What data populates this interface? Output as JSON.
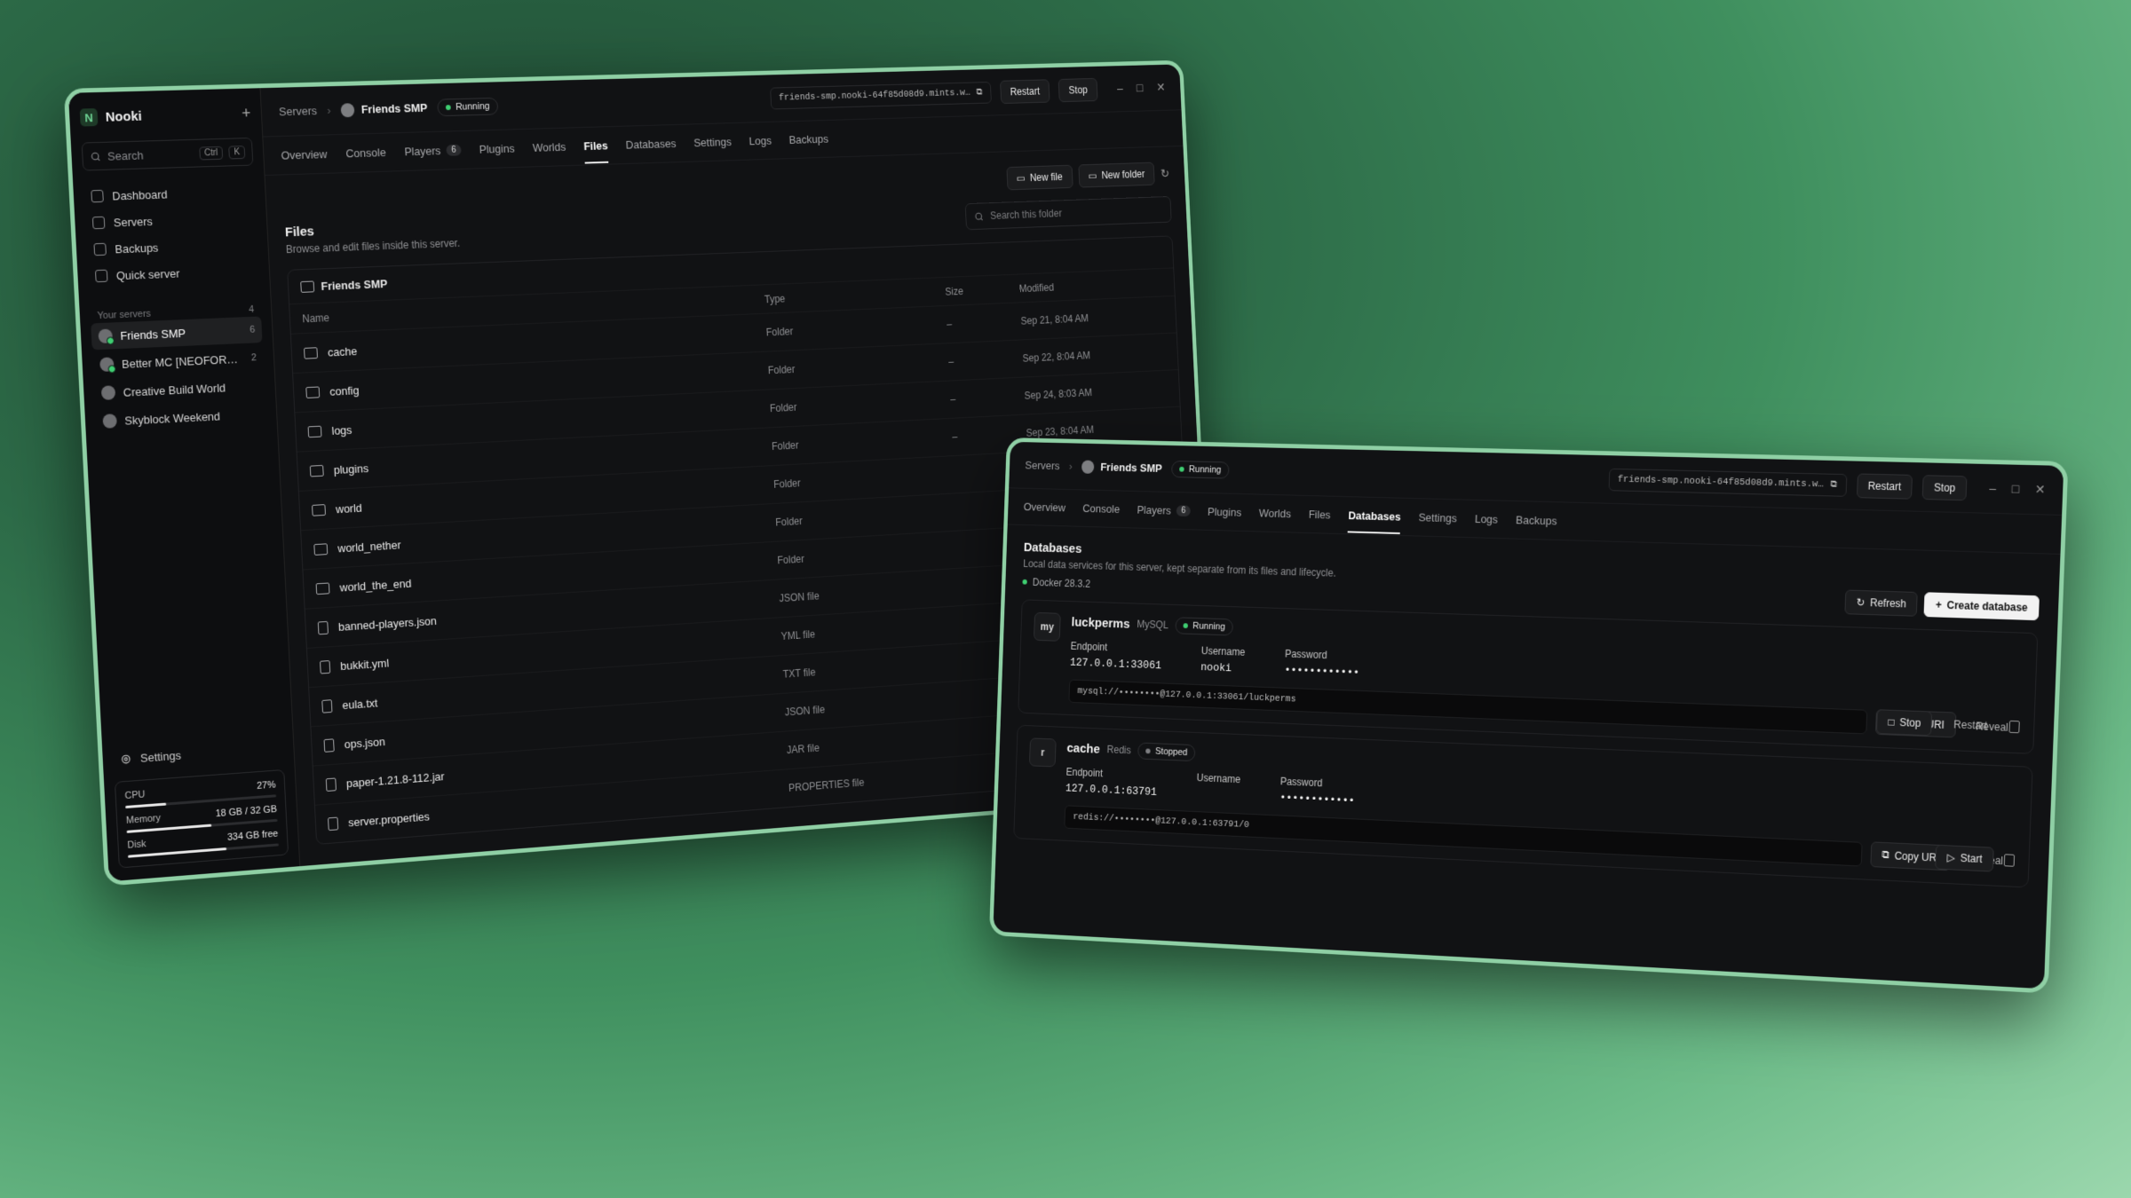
{
  "files_window": {
    "sidebar": {
      "app_name": "Nooki",
      "logo_letter": "N",
      "search_placeholder": "Search",
      "shortcut": [
        "Ctrl",
        "K"
      ],
      "nav": [
        "Dashboard",
        "Servers",
        "Backups",
        "Quick server"
      ],
      "section_label": "Your servers",
      "section_count": "4",
      "servers": [
        {
          "name": "Friends SMP",
          "count": "6",
          "active": true
        },
        {
          "name": "Better MC [NEOFORGE] ...",
          "count": "2",
          "active": false
        },
        {
          "name": "Creative Build World",
          "count": "",
          "active": false
        },
        {
          "name": "Skyblock Weekend",
          "count": "",
          "active": false
        }
      ],
      "settings_label": "Settings",
      "stats": {
        "cpu": {
          "label": "CPU",
          "value": "27%",
          "fraction": 0.27
        },
        "memory": {
          "label": "Memory",
          "value": "18 GB / 32 GB",
          "fraction": 0.56
        },
        "disk": {
          "label": "Disk",
          "value": "334 GB free",
          "fraction": 0.65
        }
      }
    },
    "header": {
      "breadcrumb_root": "Servers",
      "server_name": "Friends SMP",
      "status": "Running",
      "address": "friends-smp.nooki-64f85d08d9.mints.w…",
      "restart_label": "Restart",
      "stop_label": "Stop"
    },
    "tabs": [
      {
        "label": "Overview"
      },
      {
        "label": "Console"
      },
      {
        "label": "Players",
        "badge": "6"
      },
      {
        "label": "Plugins"
      },
      {
        "label": "Worlds"
      },
      {
        "label": "Files",
        "active": true
      },
      {
        "label": "Databases"
      },
      {
        "label": "Settings"
      },
      {
        "label": "Logs"
      },
      {
        "label": "Backups"
      }
    ],
    "files": {
      "title": "Files",
      "subtitle": "Browse and edit files inside this server.",
      "new_file_label": "New file",
      "new_folder_label": "New folder",
      "search_placeholder": "Search this folder",
      "root": "Friends SMP",
      "columns": [
        "Name",
        "Type",
        "Size",
        "Modified"
      ],
      "rows": [
        {
          "name": "cache",
          "type": "Folder",
          "size": "–",
          "modified": "Sep 21, 8:04 AM",
          "kind": "folder"
        },
        {
          "name": "config",
          "type": "Folder",
          "size": "–",
          "modified": "Sep 22, 8:04 AM",
          "kind": "folder"
        },
        {
          "name": "logs",
          "type": "Folder",
          "size": "–",
          "modified": "Sep 24, 8:03 AM",
          "kind": "folder"
        },
        {
          "name": "plugins",
          "type": "Folder",
          "size": "–",
          "modified": "Sep 23, 8:04 AM",
          "kind": "folder"
        },
        {
          "name": "world",
          "type": "Folder",
          "size": "",
          "modified": "",
          "kind": "folder"
        },
        {
          "name": "world_nether",
          "type": "Folder",
          "size": "",
          "modified": "",
          "kind": "folder"
        },
        {
          "name": "world_the_end",
          "type": "Folder",
          "size": "",
          "modified": "",
          "kind": "folder"
        },
        {
          "name": "banned-players.json",
          "type": "JSON file",
          "size": "",
          "modified": "",
          "kind": "doc"
        },
        {
          "name": "bukkit.yml",
          "type": "YML file",
          "size": "",
          "modified": "",
          "kind": "doc"
        },
        {
          "name": "eula.txt",
          "type": "TXT file",
          "size": "",
          "modified": "",
          "kind": "doc"
        },
        {
          "name": "ops.json",
          "type": "JSON file",
          "size": "",
          "modified": "",
          "kind": "doc"
        },
        {
          "name": "paper-1.21.8-112.jar",
          "type": "JAR file",
          "size": "",
          "modified": "",
          "kind": "doc"
        },
        {
          "name": "server.properties",
          "type": "PROPERTIES file",
          "size": "",
          "modified": "",
          "kind": "doc"
        }
      ]
    }
  },
  "db_window": {
    "header": {
      "breadcrumb_root": "Servers",
      "server_name": "Friends SMP",
      "status": "Running",
      "address": "friends-smp.nooki-64f85d08d9.mints.w…",
      "restart_label": "Restart",
      "stop_label": "Stop"
    },
    "tabs": [
      {
        "label": "Overview"
      },
      {
        "label": "Console"
      },
      {
        "label": "Players",
        "badge": "6"
      },
      {
        "label": "Plugins"
      },
      {
        "label": "Worlds"
      },
      {
        "label": "Files"
      },
      {
        "label": "Databases",
        "active": true
      },
      {
        "label": "Settings"
      },
      {
        "label": "Logs"
      },
      {
        "label": "Backups"
      }
    ],
    "databases": {
      "title": "Databases",
      "subtitle": "Local data services for this server, kept separate from its files and lifecycle.",
      "docker": "Docker 28.3.2",
      "refresh_label": "Refresh",
      "create_label": "Create database",
      "items": [
        {
          "mono": "my",
          "name": "luckperms",
          "engine": "MySQL",
          "status": "Running",
          "running": true,
          "endpoint_label": "Endpoint",
          "endpoint": "127.0.0.1:33061",
          "username_label": "Username",
          "username": "nooki",
          "password_label": "Password",
          "password": "••••••••••••",
          "uri": "mysql://••••••••@127.0.0.1:33061/luckperms",
          "copy_label": "Copy URI",
          "reveal_label": "Reveal",
          "primary_action": "Stop",
          "secondary_action": "Restart"
        },
        {
          "mono": "r",
          "name": "cache",
          "engine": "Redis",
          "status": "Stopped",
          "running": false,
          "endpoint_label": "Endpoint",
          "endpoint": "127.0.0.1:63791",
          "username_label": "Username",
          "username": "",
          "password_label": "Password",
          "password": "••••••••••••",
          "uri": "redis://••••••••@127.0.0.1:63791/0",
          "copy_label": "Copy URI",
          "reveal_label": "Reveal",
          "primary_action": "Start",
          "secondary_action": ""
        }
      ]
    }
  },
  "colors": {
    "accent_green": "#3fcf72",
    "window_border": "#8fd0a5",
    "surface": "#111214"
  }
}
